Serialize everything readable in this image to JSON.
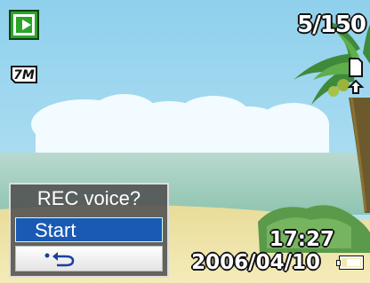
{
  "status": {
    "counter": "5/150",
    "resolution": "7M",
    "time": "17:27",
    "date": "2006/04/10",
    "battery_level": 0.75
  },
  "menu": {
    "title": "REC voice?",
    "options": [
      "Start"
    ],
    "back_icon": "back-arrow-icon"
  },
  "colors": {
    "mode_green": "#2aa528",
    "highlight_blue": "#1a59b4"
  }
}
